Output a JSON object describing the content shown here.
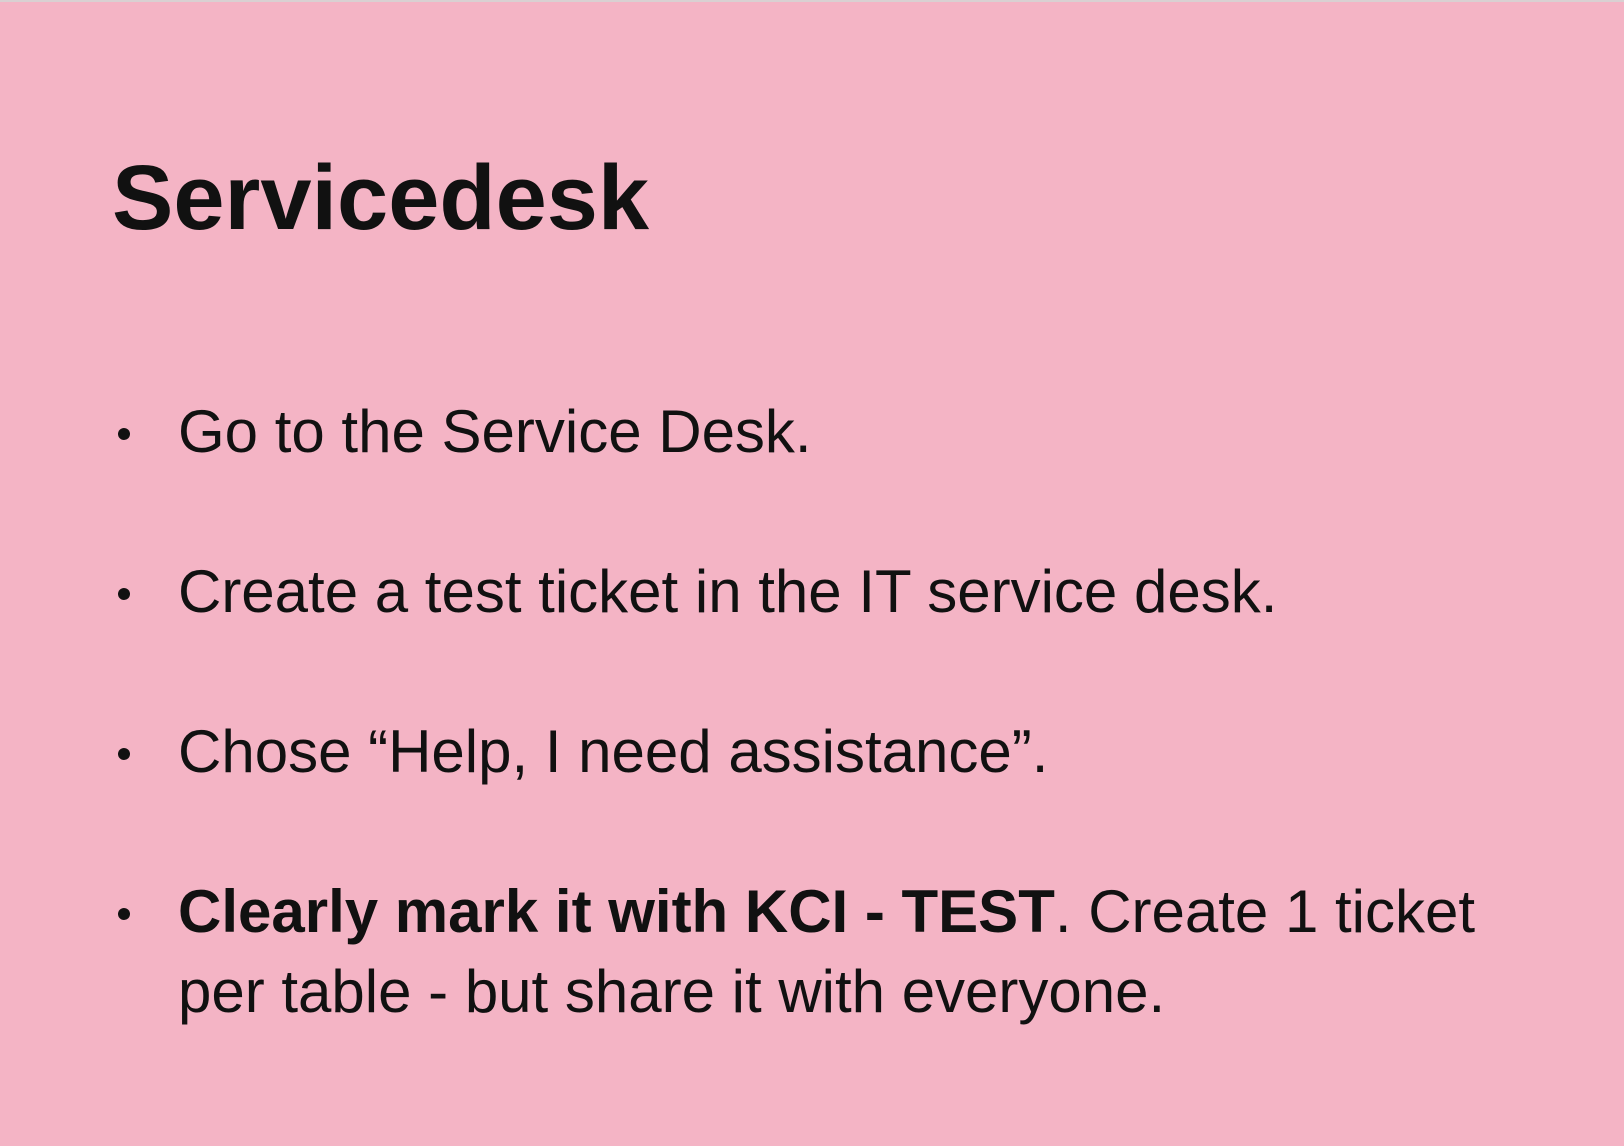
{
  "slide": {
    "title": "Servicedesk",
    "bullets": [
      {
        "text": "Go to the Service Desk."
      },
      {
        "text": "Create a test ticket in the IT service desk."
      },
      {
        "text": "Chose “Help, I need assistance”."
      },
      {
        "bold_text": "Clearly mark it with KCI - TEST",
        "text": ". Create 1 ticket per table - but share it with everyone."
      }
    ]
  },
  "colors": {
    "background": "#f4b4c5",
    "text": "#111111"
  }
}
